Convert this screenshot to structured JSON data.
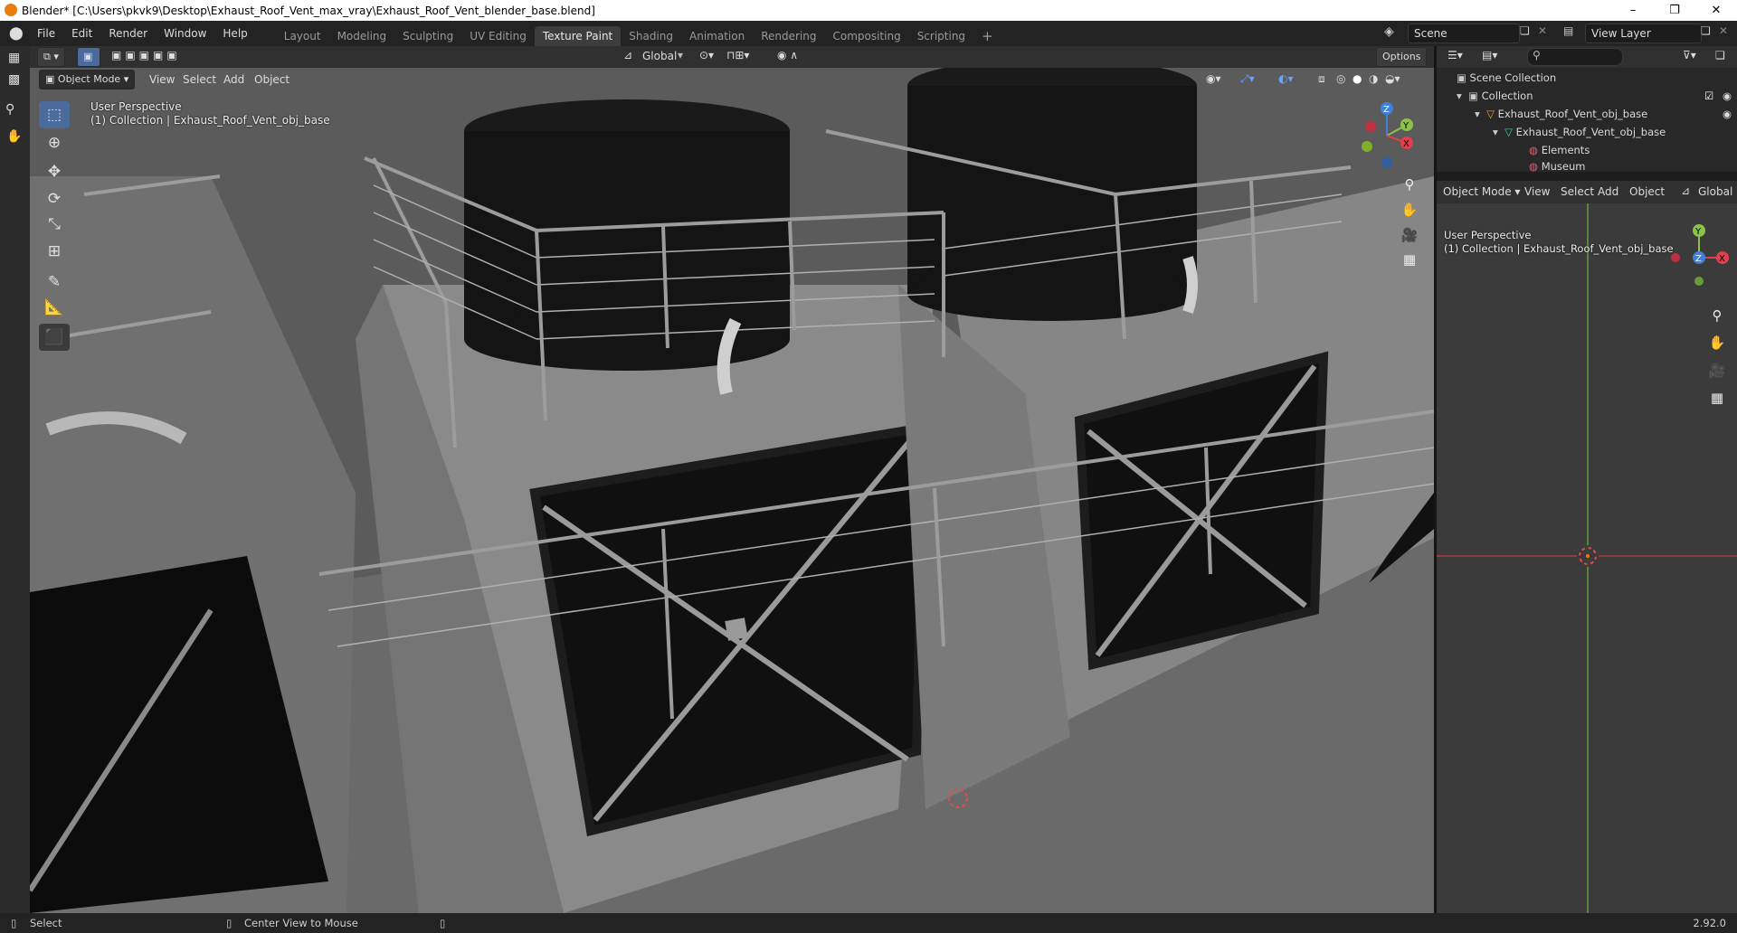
{
  "window": {
    "title": "Blender* [C:\\Users\\pkvk9\\Desktop\\Exhaust_Roof_Vent_max_vray\\Exhaust_Roof_Vent_blender_base.blend]",
    "minimize": "–",
    "maximize": "❐",
    "close": "✕"
  },
  "menubar": {
    "items": [
      "File",
      "Edit",
      "Render",
      "Window",
      "Help"
    ]
  },
  "workspaces": {
    "tabs": [
      "Layout",
      "Modeling",
      "Sculpting",
      "UV Editing",
      "Texture Paint",
      "Shading",
      "Animation",
      "Rendering",
      "Compositing",
      "Scripting"
    ],
    "active": "Texture Paint",
    "add": "+"
  },
  "scene": {
    "name": "Scene"
  },
  "view_layer": {
    "name": "View Layer"
  },
  "viewport_header": {
    "mode": "Object Mode",
    "menus": [
      "View",
      "Select",
      "Add",
      "Object"
    ],
    "orientation": "Global",
    "options": "Options"
  },
  "viewport": {
    "perspective": "User Perspective",
    "collection": "(1) Collection | Exhaust_Roof_Vent_obj_base",
    "gizmo": {
      "z": "Z",
      "y": "Y",
      "x": "X"
    }
  },
  "outliner": {
    "search_placeholder": "",
    "rows": [
      {
        "label": "Scene Collection"
      },
      {
        "label": "Collection"
      },
      {
        "label": "Exhaust_Roof_Vent_obj_base"
      },
      {
        "label": "Exhaust_Roof_Vent_obj_base"
      },
      {
        "label": "Elements"
      },
      {
        "label": "Museum"
      }
    ]
  },
  "view2_header": {
    "mode": "Object Mode",
    "menus": [
      "View",
      "Select",
      "Add",
      "Object"
    ],
    "orientation": "Global"
  },
  "view2": {
    "perspective": "User Perspective",
    "collection": "(1) Collection | Exhaust_Roof_Vent_obj_base",
    "gizmo": {
      "y": "Y",
      "z": "Z",
      "x": "X"
    }
  },
  "statusbar": {
    "select": "Select",
    "center": "Center View to Mouse",
    "version": "2.92.0"
  },
  "colors": {
    "accent_blue": "#4a6b9b",
    "axis_x": "#e0404e",
    "axis_y": "#8bc34a",
    "axis_z": "#3f7fe0",
    "brand": "#e87d0d"
  }
}
